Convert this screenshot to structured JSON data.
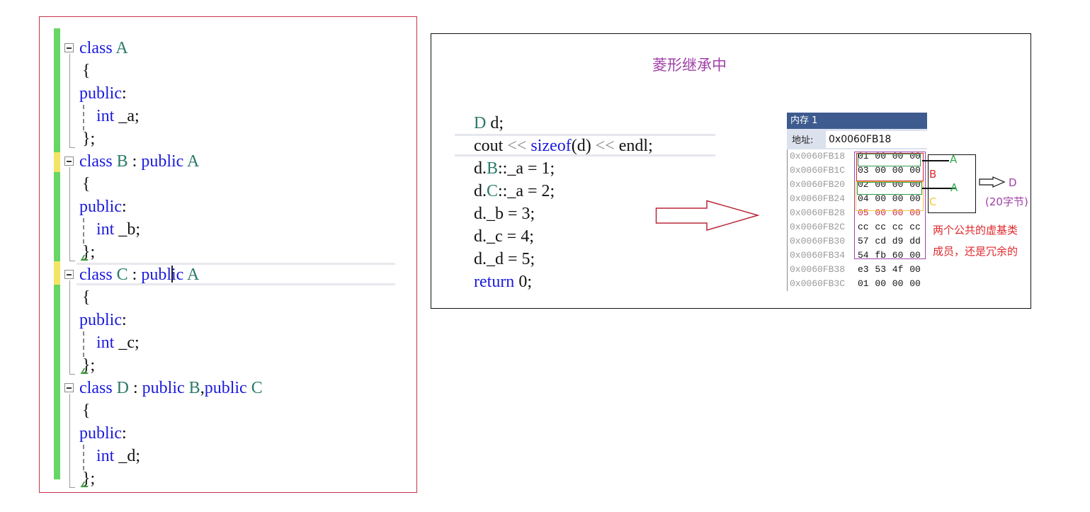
{
  "editor": {
    "lines": [
      {
        "tokens": [
          {
            "t": "class ",
            "c": "kw"
          },
          {
            "t": "A",
            "c": "ty"
          }
        ]
      },
      {
        "tokens": [
          {
            "t": "{",
            "c": ""
          }
        ]
      },
      {
        "tokens": [
          {
            "t": "public",
            "c": "kw"
          },
          {
            "t": ":",
            "c": ""
          }
        ]
      },
      {
        "tokens": [
          {
            "t": "    ",
            "c": ""
          },
          {
            "t": "int",
            "c": "kw"
          },
          {
            "t": " _a;",
            "c": ""
          }
        ]
      },
      {
        "tokens": [
          {
            "t": "};",
            "c": ""
          }
        ]
      },
      {
        "tokens": [
          {
            "t": "class ",
            "c": "kw"
          },
          {
            "t": "B",
            "c": "ty"
          },
          {
            "t": " : ",
            "c": ""
          },
          {
            "t": "public ",
            "c": "kw"
          },
          {
            "t": "A",
            "c": "ty"
          }
        ]
      },
      {
        "tokens": [
          {
            "t": "{",
            "c": ""
          }
        ]
      },
      {
        "tokens": [
          {
            "t": "public",
            "c": "kw"
          },
          {
            "t": ":",
            "c": ""
          }
        ]
      },
      {
        "tokens": [
          {
            "t": "    ",
            "c": ""
          },
          {
            "t": "int",
            "c": "kw"
          },
          {
            "t": " _b;",
            "c": ""
          }
        ]
      },
      {
        "tokens": [
          {
            "t": "};",
            "c": ""
          }
        ]
      },
      {
        "tokens": [
          {
            "t": "class ",
            "c": "kw"
          },
          {
            "t": "C",
            "c": "ty"
          },
          {
            "t": " : ",
            "c": ""
          },
          {
            "t": "public ",
            "c": "kw"
          },
          {
            "t": "A",
            "c": "ty"
          }
        ]
      },
      {
        "tokens": [
          {
            "t": "{",
            "c": ""
          }
        ]
      },
      {
        "tokens": [
          {
            "t": "public",
            "c": "kw"
          },
          {
            "t": ":",
            "c": ""
          }
        ]
      },
      {
        "tokens": [
          {
            "t": "    ",
            "c": ""
          },
          {
            "t": "int",
            "c": "kw"
          },
          {
            "t": " _c;",
            "c": ""
          }
        ]
      },
      {
        "tokens": [
          {
            "t": "};",
            "c": ""
          }
        ]
      },
      {
        "tokens": [
          {
            "t": "class ",
            "c": "kw"
          },
          {
            "t": "D",
            "c": "ty"
          },
          {
            "t": " : ",
            "c": ""
          },
          {
            "t": "public ",
            "c": "kw"
          },
          {
            "t": "B",
            "c": "ty"
          },
          {
            "t": ",",
            "c": ""
          },
          {
            "t": "public ",
            "c": "kw"
          },
          {
            "t": "C",
            "c": "ty"
          }
        ]
      },
      {
        "tokens": [
          {
            "t": "{",
            "c": ""
          }
        ]
      },
      {
        "tokens": [
          {
            "t": "public",
            "c": "kw"
          },
          {
            "t": ":",
            "c": ""
          }
        ]
      },
      {
        "tokens": [
          {
            "t": "    ",
            "c": ""
          },
          {
            "t": "int",
            "c": "kw"
          },
          {
            "t": " _d;",
            "c": ""
          }
        ]
      },
      {
        "tokens": [
          {
            "t": "};",
            "c": ""
          }
        ]
      }
    ]
  },
  "slide": {
    "title": "菱形继承中",
    "code": [
      {
        "tokens": [
          {
            "t": "D",
            "c": "ty"
          },
          {
            "t": " d;",
            "c": ""
          }
        ]
      },
      {
        "tokens": [
          {
            "t": "cout ",
            "c": ""
          },
          {
            "t": "<<",
            "c": "op"
          },
          {
            "t": " ",
            "c": ""
          },
          {
            "t": "sizeof",
            "c": "kw"
          },
          {
            "t": "(d) ",
            "c": ""
          },
          {
            "t": "<<",
            "c": "op"
          },
          {
            "t": " endl;",
            "c": ""
          }
        ]
      },
      {
        "tokens": [
          {
            "t": "d.",
            "c": ""
          },
          {
            "t": "B",
            "c": "ty"
          },
          {
            "t": "::_a = 1;",
            "c": ""
          }
        ]
      },
      {
        "tokens": [
          {
            "t": "d.",
            "c": ""
          },
          {
            "t": "C",
            "c": "ty"
          },
          {
            "t": "::_a = 2;",
            "c": ""
          }
        ]
      },
      {
        "tokens": [
          {
            "t": "d._b = 3;",
            "c": ""
          }
        ]
      },
      {
        "tokens": [
          {
            "t": "d._c = 4;",
            "c": ""
          }
        ]
      },
      {
        "tokens": [
          {
            "t": "d._d = 5;",
            "c": ""
          }
        ]
      },
      {
        "tokens": [
          {
            "t": "return",
            "c": "kw"
          },
          {
            "t": " 0;",
            "c": ""
          }
        ]
      }
    ],
    "memory": {
      "title": "内存 1",
      "address_label": "地址:",
      "address_value": "0x0060FB18",
      "rows": [
        {
          "addr": "0x0060FB18",
          "bytes": "01 00 00 00"
        },
        {
          "addr": "0x0060FB1C",
          "bytes": "03 00 00 00"
        },
        {
          "addr": "0x0060FB20",
          "bytes": "02 00 00 00"
        },
        {
          "addr": "0x0060FB24",
          "bytes": "04 00 00 00"
        },
        {
          "addr": "0x0060FB28",
          "bytes": "05 00 00 00",
          "red": true
        },
        {
          "addr": "0x0060FB2C",
          "bytes": "cc cc cc cc"
        },
        {
          "addr": "0x0060FB30",
          "bytes": "57 cd d9 dd"
        },
        {
          "addr": "0x0060FB34",
          "bytes": "54 fb 60 00"
        },
        {
          "addr": "0x0060FB38",
          "bytes": "e3 53 4f 00"
        },
        {
          "addr": "0x0060FB3C",
          "bytes": "01 00 00 00"
        }
      ]
    },
    "labels": {
      "a1": "A",
      "b": "B",
      "a2": "A",
      "c": "C",
      "d": "D",
      "size": "(20字节)"
    },
    "annotation": "两个公共的虚基类成员，还是冗余的",
    "colors": {
      "title": "#a040a8",
      "a_label": "#2eaa4a",
      "b_label": "#e0282c",
      "c_label": "#f2c83a",
      "d_label": "#a040a8",
      "annotation": "#e0282c",
      "arrow": "#b8283a"
    }
  }
}
